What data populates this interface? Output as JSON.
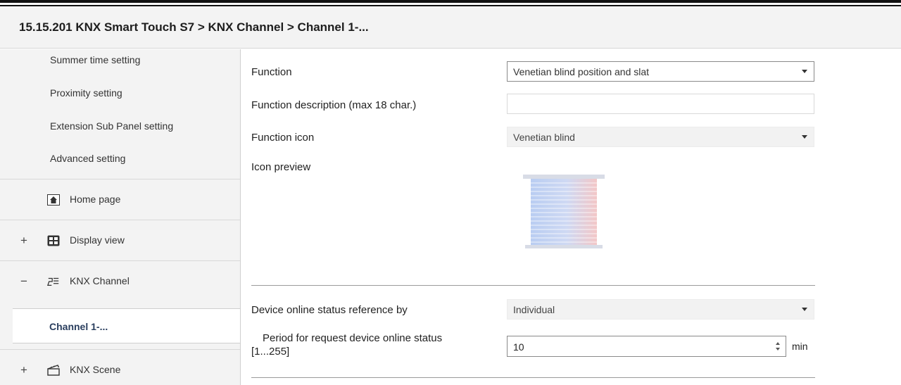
{
  "breadcrumb": "15.15.201 KNX Smart Touch S7 > KNX Channel  > Channel 1-...",
  "sidebar": {
    "sub_items": [
      "Summer time setting",
      "Proximity setting",
      "Extension Sub Panel setting",
      "Advanced setting"
    ],
    "nav": {
      "home": {
        "sign": "",
        "label": "Home page",
        "icon": "home-icon"
      },
      "display": {
        "sign": "+",
        "label": "Display view",
        "icon": "display-view-icon"
      },
      "knx_channel": {
        "sign": "−",
        "label": "KNX Channel",
        "icon": "knx-channel-icon"
      },
      "knx_scene": {
        "sign": "+",
        "label": "KNX Scene",
        "icon": "clapperboard-icon"
      }
    },
    "active_child": "Channel 1-..."
  },
  "main": {
    "function": {
      "label": "Function",
      "value": "Venetian blind position and slat"
    },
    "description": {
      "label": "Function description (max 18 char.)",
      "value": ""
    },
    "icon": {
      "label": "Function icon",
      "value": "Venetian blind"
    },
    "preview": {
      "label": "Icon preview",
      "icon": "venetian-blind-icon"
    },
    "online_ref": {
      "label": "Device online status reference by",
      "value": "Individual"
    },
    "period": {
      "label_line1": "Period for request device online status",
      "label_line2": "[1...255]",
      "value": "10",
      "unit": "min"
    }
  }
}
